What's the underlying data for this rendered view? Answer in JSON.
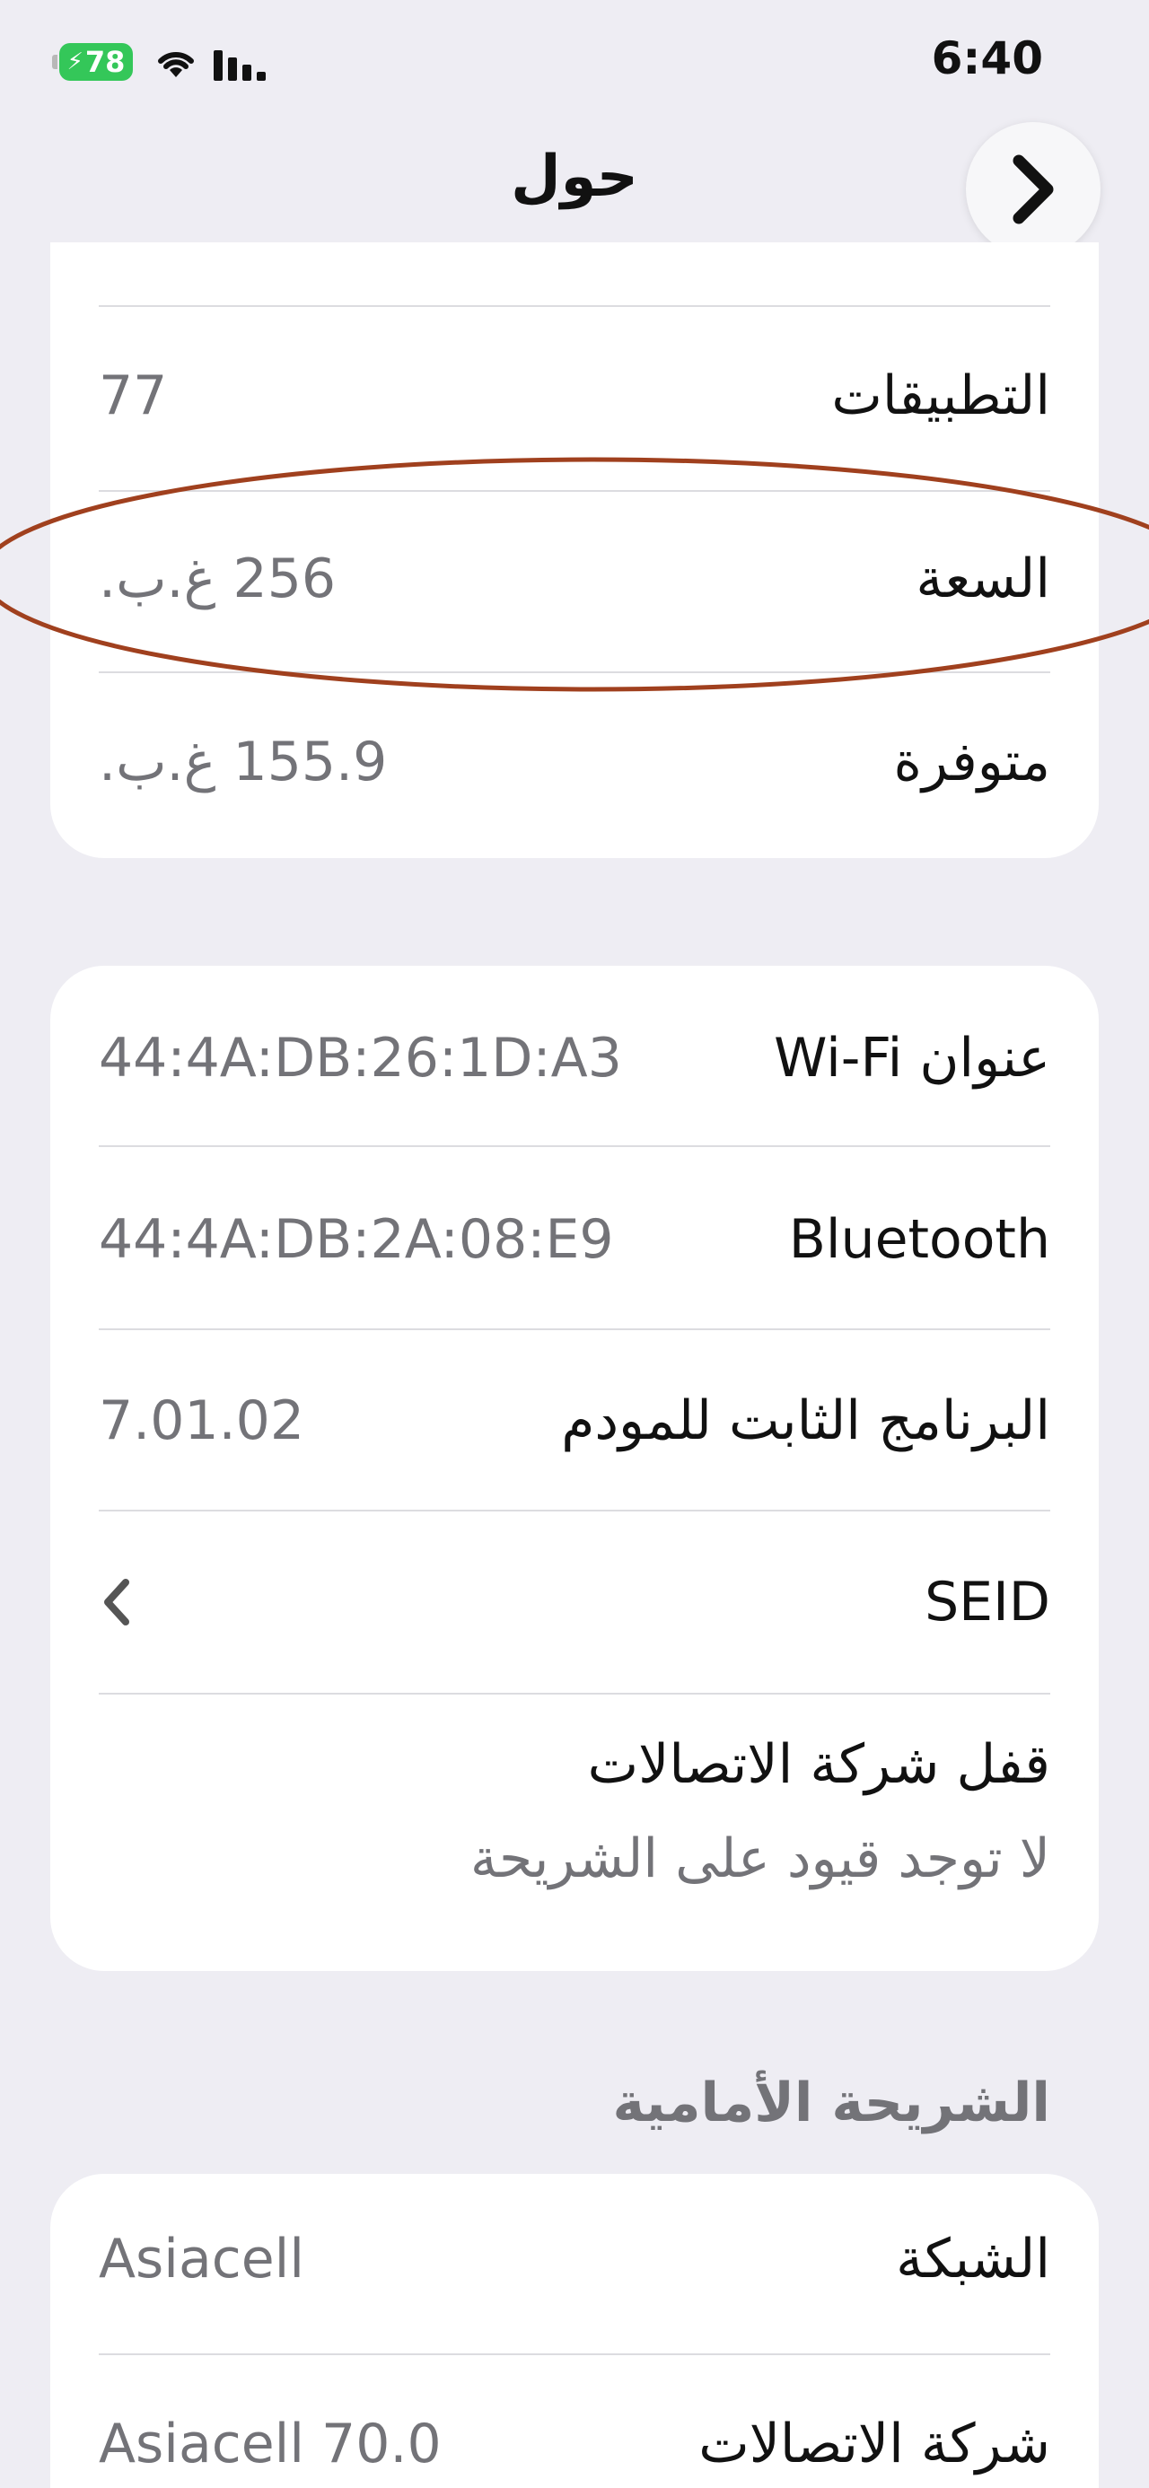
{
  "status_bar": {
    "battery_level": "78",
    "time": "6:40"
  },
  "nav": {
    "title": "حول"
  },
  "card1": {
    "rows": [
      {
        "label": "التطبيقات",
        "value": "77"
      },
      {
        "label": "السعة",
        "value": "256 غ.ب."
      },
      {
        "label": "متوفرة",
        "value": "155.9 غ.ب."
      }
    ]
  },
  "card2": {
    "rows": [
      {
        "label": "عنوان Wi-Fi",
        "value": "44:4A:DB:26:1D:A3"
      },
      {
        "label": "Bluetooth",
        "value": "44:4A:DB:2A:08:E9"
      },
      {
        "label": "البرنامج الثابت للمودم",
        "value": "7.01.02"
      },
      {
        "label": "SEID",
        "value": ""
      }
    ],
    "carrier_lock": {
      "label": "قفل شركة الاتصالات",
      "value": "لا توجد قيود على الشريحة"
    }
  },
  "section_front_sim": {
    "header": "الشريحة الأمامية",
    "rows": [
      {
        "label": "الشبكة",
        "value": "Asiacell"
      },
      {
        "label": "شركة الاتصالات",
        "value": "Asiacell 70.0"
      }
    ]
  },
  "colors": {
    "background": "#EEEDF3",
    "card": "#FFFFFF",
    "secondary_text": "#737378",
    "battery_green": "#34C759",
    "annotation_ellipse": "#A0401E"
  }
}
